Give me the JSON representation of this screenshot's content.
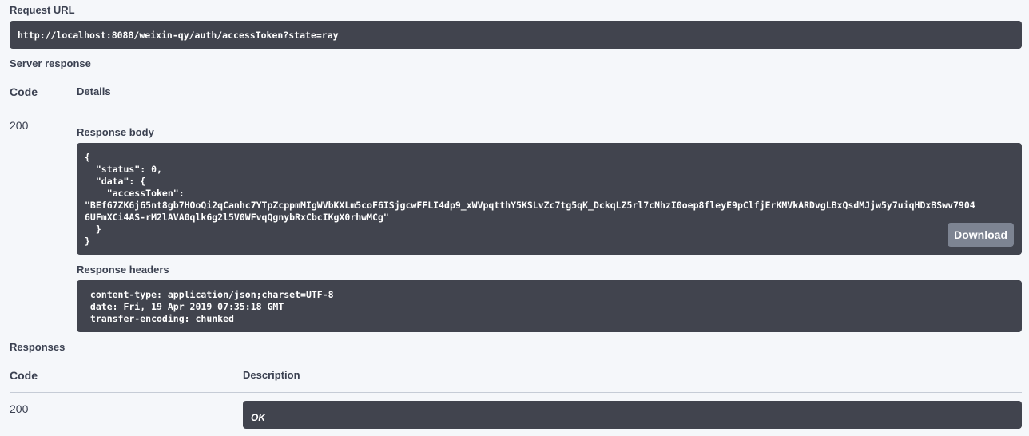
{
  "request": {
    "label": "Request URL",
    "url": "http://localhost:8088/weixin-qy/auth/accessToken?state=ray"
  },
  "server_response": {
    "label": "Server response",
    "col_code": "Code",
    "col_details": "Details",
    "status_code": "200",
    "body_label": "Response body",
    "body_lines": [
      "{",
      "  \"status\": 0,",
      "  \"data\": {",
      "    \"accessToken\": ",
      "\"BEf67ZK6j65nt8gb7HOoQi2qCanhc7YTpZcppmMIgWVbKXLm5coF6ISjgcwFFLI4dp9_xWVpqtthY5KSLvZc7tg5qK_DckqLZ5rl7cNhzI0oep8fleyE9pClfjErKMVkARDvgLBxQsdMJjw5y7uiqHDxBSwv7904",
      "6UFmXCi4AS-rM2lAVA0qlk6g2l5V0WFvqQgnybRxCbcIKgX0rhwMCg\"",
      "  }",
      "}"
    ],
    "download_label": "Download",
    "headers_label": "Response headers",
    "header_lines": [
      " content-type: application/json;charset=UTF-8",
      " date: Fri, 19 Apr 2019 07:35:18 GMT",
      " transfer-encoding: chunked"
    ]
  },
  "responses": {
    "label": "Responses",
    "col_code": "Code",
    "col_description": "Description",
    "status_code": "200",
    "description": "OK"
  }
}
